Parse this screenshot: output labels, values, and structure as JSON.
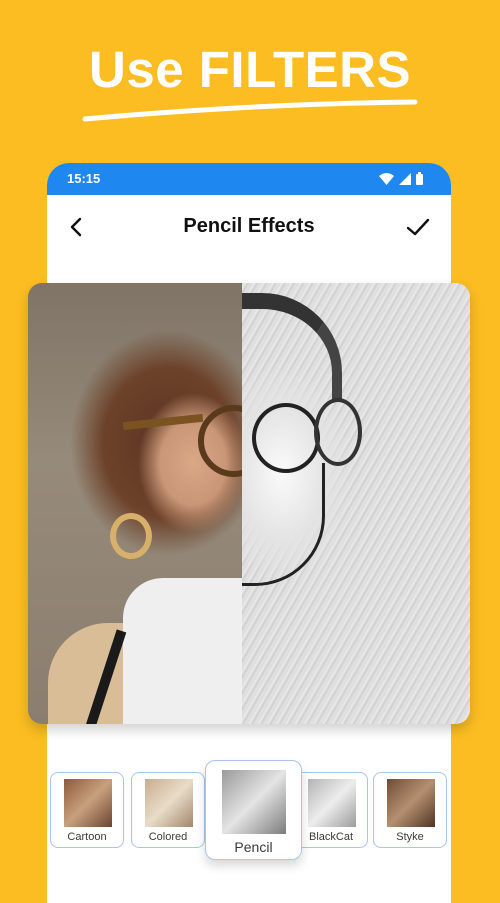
{
  "promo": {
    "headline": "Use FILTERS"
  },
  "statusbar": {
    "time": "15:15",
    "icons": [
      "wifi-icon",
      "signal-icon",
      "battery-icon"
    ]
  },
  "appbar": {
    "title": "Pencil Effects",
    "back_icon": "chevron-left-icon",
    "confirm_icon": "check-icon"
  },
  "preview": {
    "left_label": "original photo",
    "right_label": "pencil sketch"
  },
  "filters": {
    "selected": "Pencil",
    "items": [
      {
        "label": "Cartoon"
      },
      {
        "label": "Colored"
      },
      {
        "label": "Pencil"
      },
      {
        "label": "BlackCat"
      },
      {
        "label": "Styke"
      }
    ]
  },
  "colors": {
    "background": "#FBBD22",
    "statusbar": "#1E88F0",
    "filter_border": "#A9C5EA"
  }
}
